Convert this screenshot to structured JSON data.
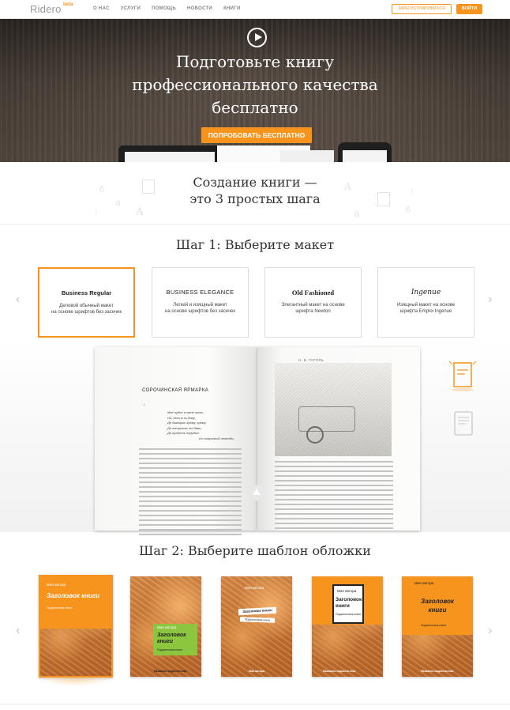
{
  "nav": {
    "logo": "Ridero",
    "logo_badge": "beta",
    "links": [
      "О НАС",
      "УСЛУГИ",
      "ПОМОЩЬ",
      "НОВОСТИ",
      "КНИГИ"
    ],
    "register_label": "ЗАРЕГИСТРИРОВАТЬСЯ",
    "login_label": "ВОЙТИ"
  },
  "hero": {
    "title_lines": [
      "Подготовьте книгу",
      "профессионального качества",
      "бесплатно"
    ],
    "cta_label": "ПОПРОБОВАТЬ БЕСПЛАТНО"
  },
  "intro": {
    "title_lines": [
      "Создание книги —",
      "это 3 простых шага"
    ]
  },
  "step1": {
    "title": "Шаг 1: Выберите макет",
    "layouts": [
      {
        "name": "Business Regular",
        "desc_lines": [
          "Деловой обычный макет",
          "на основе шрифтов без засечек"
        ],
        "active": true
      },
      {
        "name": "BUSINESS ELEGANCE",
        "desc_lines": [
          "Легкий и изящный макет",
          "на основе шрифтов без засечек"
        ],
        "active": false
      },
      {
        "name": "Old Fashioned",
        "desc_lines": [
          "Элегантный макет на основе",
          "шрифта Newton"
        ],
        "active": false
      },
      {
        "name": "Ingenue",
        "desc_lines": [
          "Изящный макет на основе",
          "шрифта Emploi Ingenue"
        ],
        "active": false
      }
    ],
    "book": {
      "chapter_title": "СОРОЧИНСКАЯ ЯРМАРКА",
      "running_head": "Н. В. ГОГОЛЬ",
      "verse_lines": [
        "Мне нудно в хате жить.",
        "Ой, вези ж из дому,",
        "Де багацько грому, грому,",
        "Де гопцюють всi дiвки,",
        "Де гуляють парубки!"
      ],
      "verse_source": "Из старинной легенды."
    }
  },
  "step2": {
    "title": "Шаг 2: Выберите шаблон обложки",
    "covers": [
      {
        "author": "Имя автора",
        "title": "Заголовок книги",
        "sub": "Подзаголовок книги",
        "pub": "",
        "active": true
      },
      {
        "author": "Имя автора",
        "title": "Заголовок книги",
        "sub": "Подзаголовок книги",
        "pub": "Название издательства",
        "active": false
      },
      {
        "author": "Имя автора",
        "title": "Заголовок книги",
        "sub": "Подзаголовок книги",
        "pub": "Имя автора",
        "active": false
      },
      {
        "author": "Имя автора",
        "title": "Заголовок книги",
        "sub": "Подзаголовок книги",
        "pub": "Название издательства",
        "active": false
      },
      {
        "author": "Имя автора",
        "title": "Заголовок книги",
        "sub": "Подзаголовок книги",
        "pub": "Название издательства",
        "active": false
      }
    ]
  },
  "colors": {
    "accent": "#f7941d",
    "text": "#333333",
    "border": "#dddddd"
  },
  "icons": {
    "play": "play-icon",
    "prev": "chevron-left-icon",
    "next": "chevron-right-icon",
    "print_book": "book-icon",
    "ebook": "tablet-icon",
    "scroll": "chevron-up-icon"
  }
}
